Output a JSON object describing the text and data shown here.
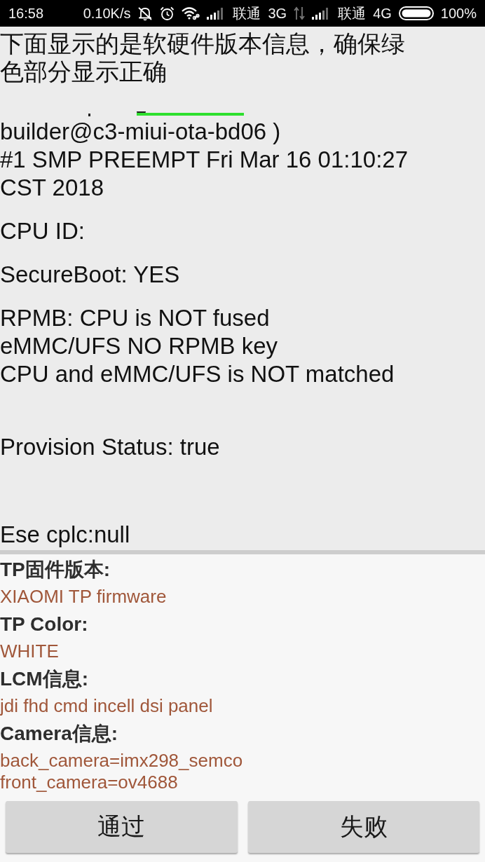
{
  "status_bar": {
    "time": "16:58",
    "net_speed": "0.10K/s",
    "sims": [
      {
        "carrier": "联通",
        "network": "3G"
      },
      {
        "carrier": "联通",
        "network": "4G"
      }
    ],
    "battery": "100%"
  },
  "intro": "下面显示的是软硬件版本信息，确保绿色部分显示正确",
  "info_blocks": [
    "builder@c3-miui-ota-bd06 )\n#1 SMP PREEMPT Fri Mar 16 01:10:27 CST 2018",
    "CPU ID:",
    "SecureBoot: YES",
    "RPMB: CPU is NOT fused\neMMC/UFS NO RPMB key\nCPU and eMMC/UFS is NOT matched",
    "Provision Status: true",
    "Ese cplc:null"
  ],
  "details": [
    {
      "label": "TP固件版本:",
      "value": "XIAOMI TP firmware"
    },
    {
      "label": "TP Color:",
      "value": "WHITE"
    },
    {
      "label": "LCM信息:",
      "value": "jdi fhd cmd incell dsi panel"
    },
    {
      "label": "Camera信息:",
      "value": "back_camera=imx298_semco\nfront_camera=ov4688"
    }
  ],
  "buttons": [
    {
      "label": "通过"
    },
    {
      "label": "失败"
    }
  ]
}
